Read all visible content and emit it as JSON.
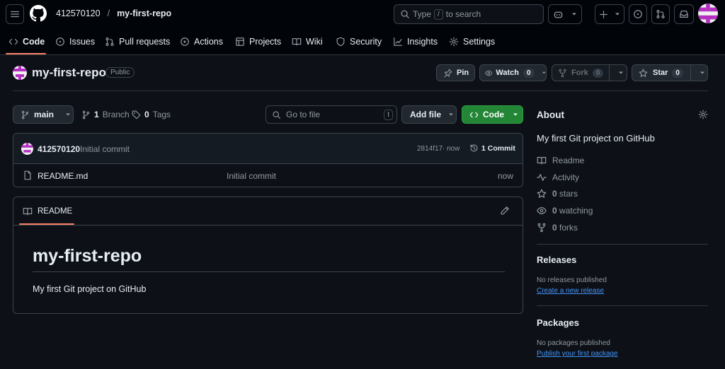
{
  "header": {
    "owner": "412570120",
    "separator": "/",
    "repo": "my-first-repo",
    "search": {
      "prefix": "Type",
      "key": "/",
      "suffix": "to search"
    }
  },
  "tabs": [
    {
      "label": "Code",
      "icon": "code-icon",
      "active": true
    },
    {
      "label": "Issues",
      "icon": "issue-icon"
    },
    {
      "label": "Pull requests",
      "icon": "pull-request-icon"
    },
    {
      "label": "Actions",
      "icon": "play-icon"
    },
    {
      "label": "Projects",
      "icon": "table-icon"
    },
    {
      "label": "Wiki",
      "icon": "book-icon"
    },
    {
      "label": "Security",
      "icon": "shield-icon"
    },
    {
      "label": "Insights",
      "icon": "graph-icon"
    },
    {
      "label": "Settings",
      "icon": "gear-icon"
    }
  ],
  "repo_header": {
    "name": "my-first-repo",
    "visibility": "Public",
    "pin": "Pin",
    "watch": "Watch",
    "watch_count": "0",
    "fork": "Fork",
    "fork_count": "0",
    "star": "Star",
    "star_count": "0"
  },
  "toolbar": {
    "branch": "main",
    "branches_count": "1",
    "branches_label": "Branch",
    "tags_count": "0",
    "tags_label": "Tags",
    "goto_placeholder": "Go to file",
    "goto_key": "t",
    "add_file": "Add file",
    "code": "Code"
  },
  "commit_bar": {
    "author": "412570120",
    "message": "Initial commit",
    "sha": "2814f17",
    "dot": "·",
    "time": "now",
    "commits": "1 Commit"
  },
  "files": [
    {
      "name": "README.md",
      "message": "Initial commit",
      "time": "now"
    }
  ],
  "readme": {
    "tab": "README",
    "heading": "my-first-repo",
    "body": "My first Git project on GitHub"
  },
  "about": {
    "title": "About",
    "description": "My first Git project on GitHub",
    "items": [
      {
        "icon": "book-icon",
        "label": "Readme"
      },
      {
        "icon": "pulse-icon",
        "label": "Activity"
      },
      {
        "icon": "star-icon",
        "count": "0",
        "label": "stars"
      },
      {
        "icon": "eye-icon",
        "count": "0",
        "label": "watching"
      },
      {
        "icon": "fork-icon",
        "count": "0",
        "label": "forks"
      }
    ]
  },
  "releases": {
    "title": "Releases",
    "empty": "No releases published",
    "link": "Create a new release"
  },
  "packages": {
    "title": "Packages",
    "empty": "No packages published",
    "link": "Publish your first package"
  },
  "colors": {
    "background": "#0d1117",
    "header": "#010409",
    "accent_green": "#238636",
    "link": "#4493f8",
    "active_tab_underline": "#f78166"
  }
}
